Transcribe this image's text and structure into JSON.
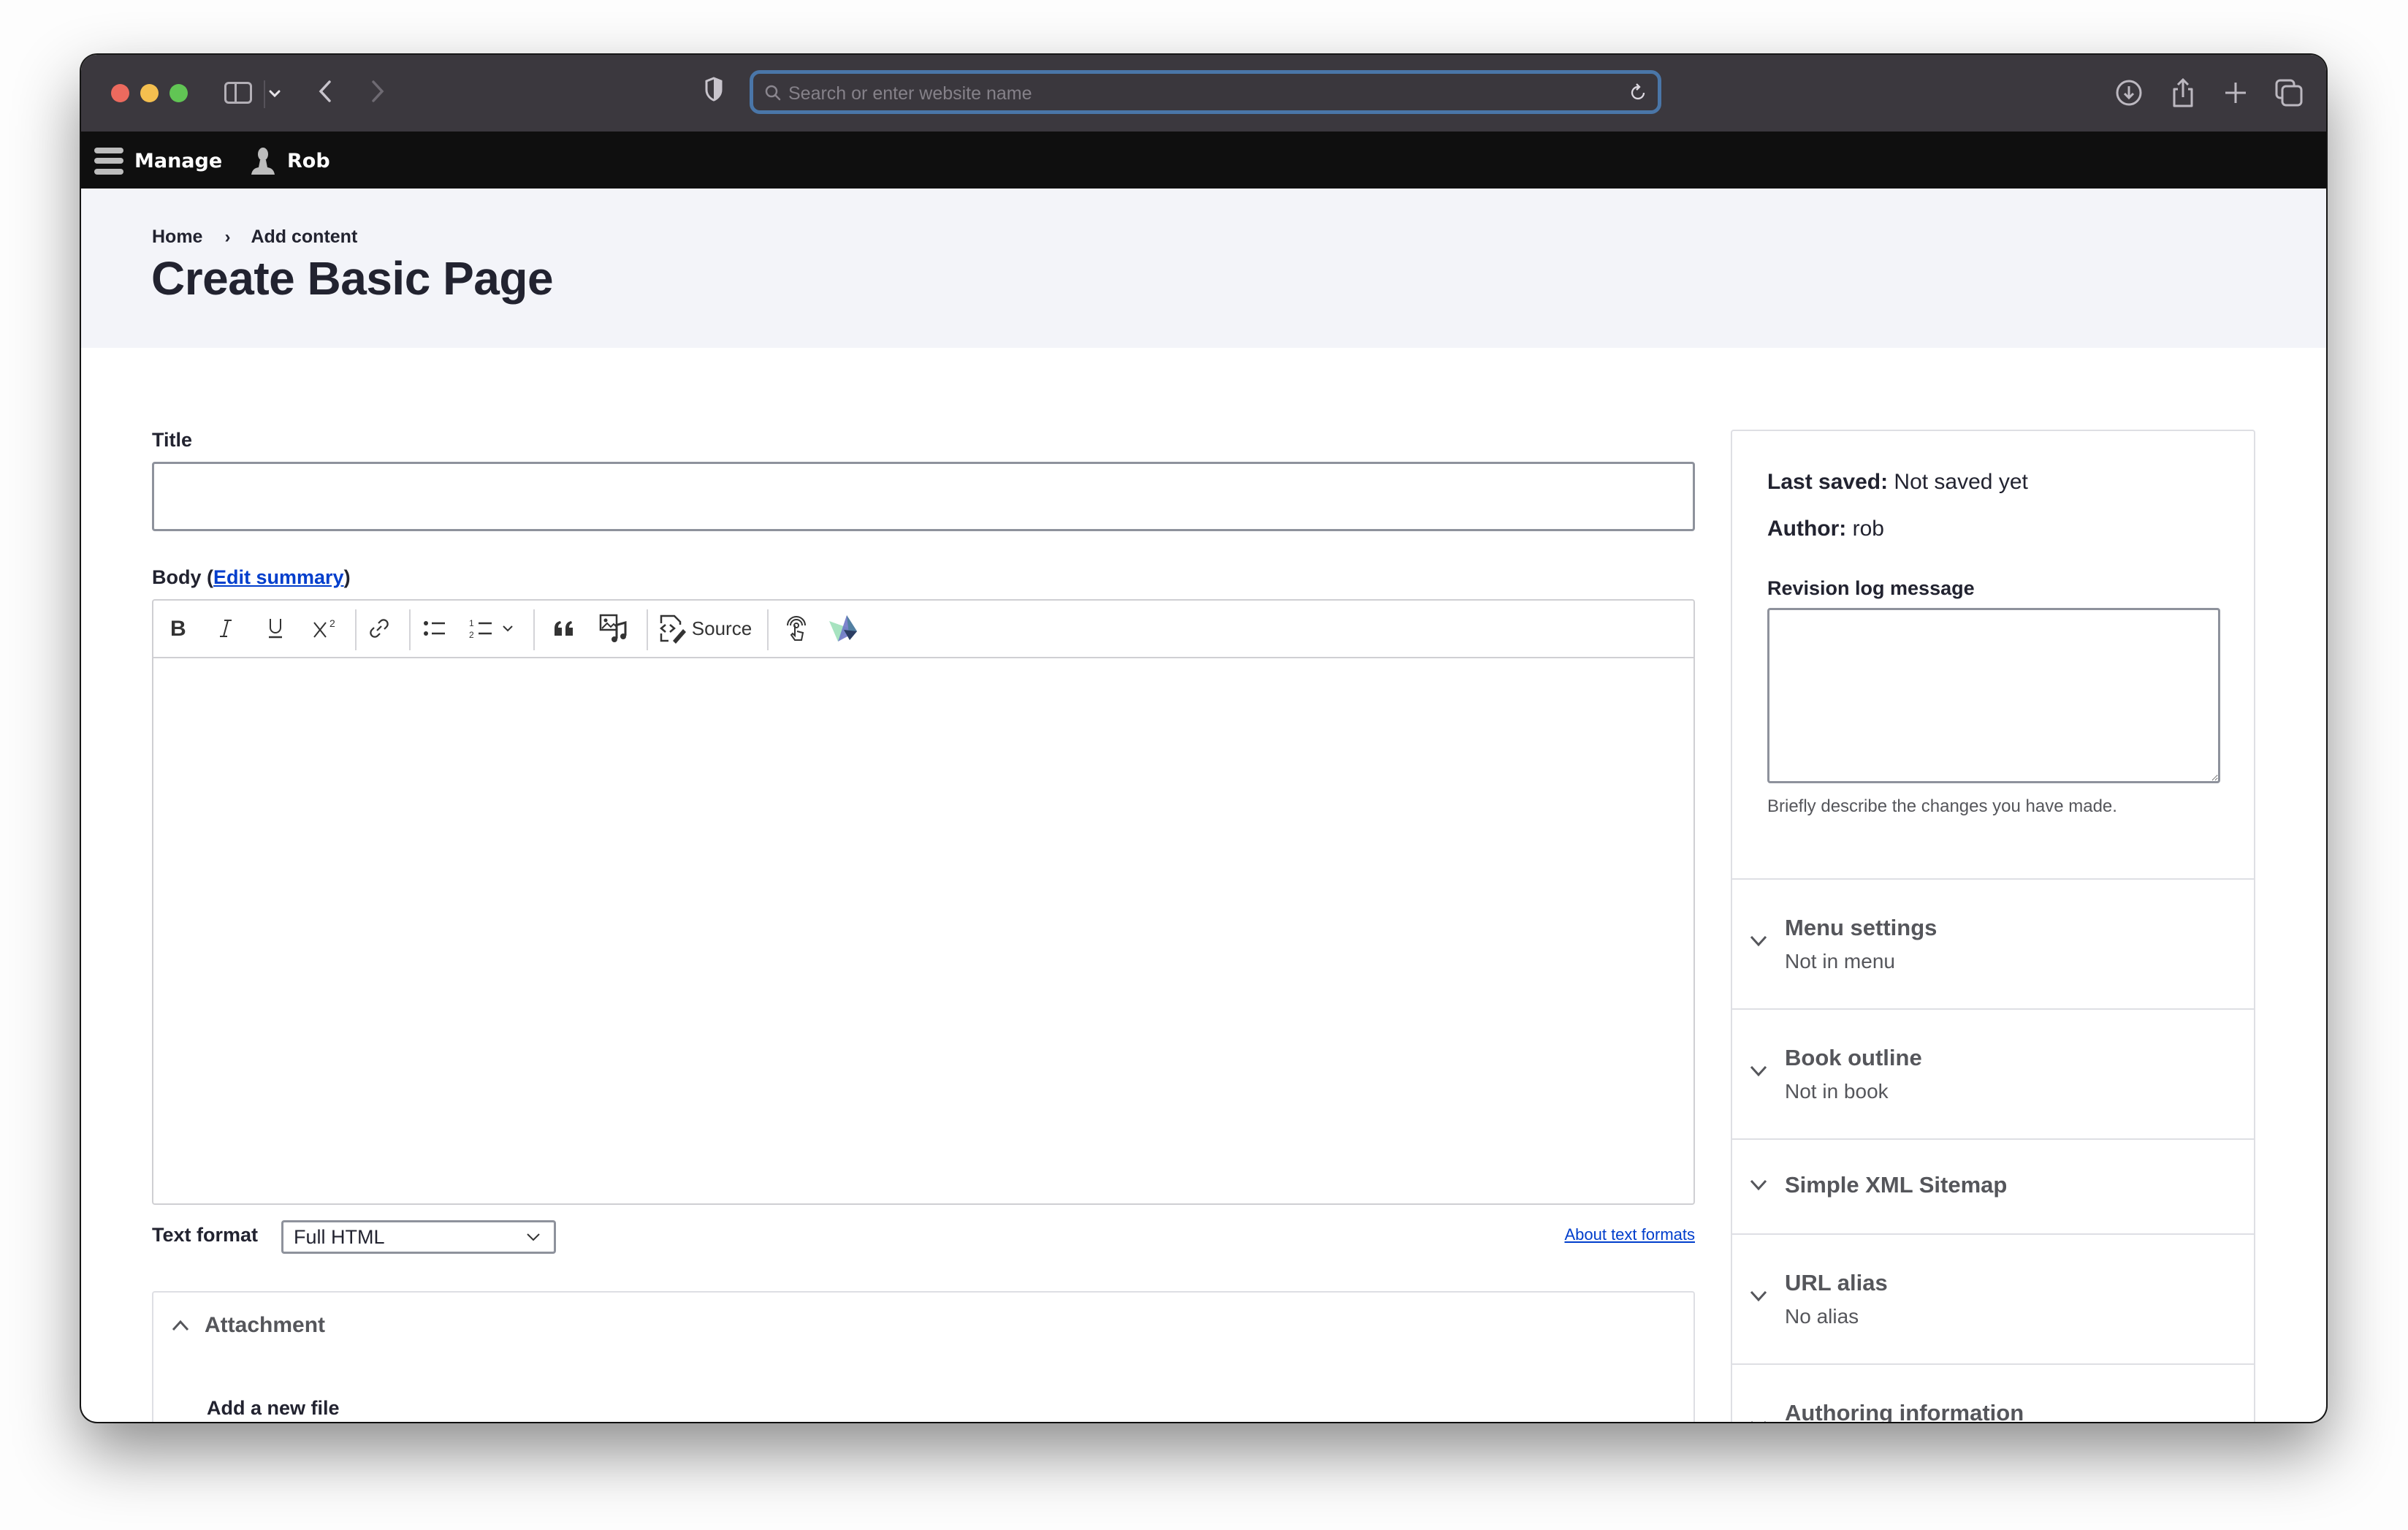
{
  "browser": {
    "address_placeholder": "Search or enter website name",
    "address_value": "",
    "icons": {
      "sidebar": "sidebar-icon",
      "back": "chevron-left-icon",
      "forward": "chevron-right-icon",
      "privacy": "shield-icon",
      "search": "search-icon",
      "reload": "reload-icon",
      "downloads": "download-icon",
      "share": "share-icon",
      "new_tab": "plus-icon",
      "tabs": "tabs-overview-icon"
    }
  },
  "toolbar": {
    "manage_label": "Manage",
    "user_label": "Rob"
  },
  "header": {
    "breadcrumb": [
      {
        "label": "Home"
      },
      {
        "label": "Add content"
      }
    ],
    "breadcrumb_separator": "›",
    "title": "Create Basic Page"
  },
  "form": {
    "title_label": "Title",
    "title_value": "",
    "body_label": "Body",
    "body_paren_open": " (",
    "body_edit_summary": "Edit summary",
    "body_paren_close": ")",
    "editor_toolbar": [
      {
        "name": "bold",
        "glyph": "B"
      },
      {
        "name": "italic",
        "glyph": "I"
      },
      {
        "name": "underline",
        "glyph": "U"
      },
      {
        "name": "superscript",
        "glyph": "X²"
      },
      {
        "name": "link",
        "glyph": "link"
      },
      {
        "name": "bulleted-list",
        "glyph": "bullets"
      },
      {
        "name": "numbered-list",
        "glyph": "numbers"
      },
      {
        "name": "blockquote",
        "glyph": "❝"
      },
      {
        "name": "insert-media",
        "glyph": "media"
      },
      {
        "name": "source",
        "glyph": "source",
        "label": "Source"
      },
      {
        "name": "accessibility-checker",
        "glyph": "touch"
      },
      {
        "name": "plugin-logo",
        "glyph": "logo"
      }
    ],
    "text_format_label": "Text format",
    "text_format_selected": "Full HTML",
    "about_text_formats": "About text formats",
    "attachment_title": "Attachment",
    "attachment_add_label": "Add a new file"
  },
  "sidebar": {
    "last_saved_label": "Last saved:",
    "last_saved_value": " Not saved yet",
    "author_label": "Author:",
    "author_value": " rob",
    "revision_label": "Revision log message",
    "revision_value": "",
    "revision_description": "Briefly describe the changes you have made.",
    "sections": [
      {
        "title": "Menu settings",
        "summary": "Not in menu"
      },
      {
        "title": "Book outline",
        "summary": "Not in book"
      },
      {
        "title": "Simple XML Sitemap",
        "summary": ""
      },
      {
        "title": "URL alias",
        "summary": "No alias"
      },
      {
        "title": "Authoring information",
        "summary": ""
      }
    ]
  },
  "colors": {
    "titlebar": "#3b383e",
    "drupal_toolbar": "#0f0f0f",
    "header_band": "#f3f4f9",
    "link": "#003ecc",
    "url_focus_ring": "#4a76a8",
    "text": "#222330",
    "muted_text": "#55565b"
  }
}
